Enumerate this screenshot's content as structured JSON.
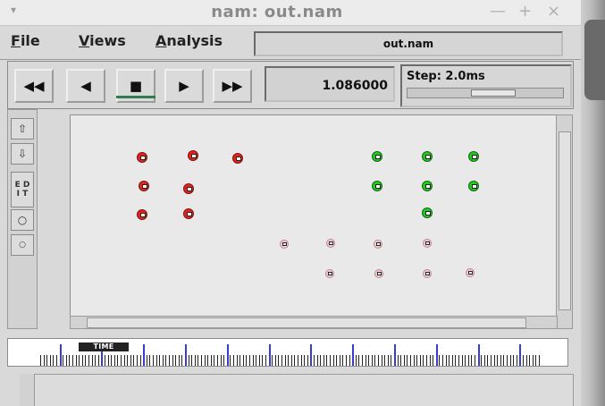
{
  "window": {
    "title": "nam: out.nam",
    "menu_arrow": "▾",
    "minimize": "—",
    "maximize": "+",
    "close": "×"
  },
  "menubar": {
    "items": [
      {
        "label": "File",
        "underline": "F",
        "rest": "ile"
      },
      {
        "label": "Views",
        "underline": "V",
        "rest": "iews"
      },
      {
        "label": "Analysis",
        "underline": "A",
        "rest": "nalysis"
      }
    ],
    "filename": "out.nam"
  },
  "playback": {
    "rewind": "◀◀",
    "back": "◀",
    "stop": "■",
    "play": "▶",
    "fast_forward": "▶▶",
    "time": "1.086000",
    "step_label": "Step: 2.0ms"
  },
  "tools": {
    "zoom_in": "⇧",
    "zoom_out": "⇩",
    "edit": "E D\nI T",
    "circle_large": "○",
    "circle_small": "○"
  },
  "timeline": {
    "label": "TIME"
  },
  "colors": {
    "node_red": "#e8231b",
    "node_green": "#1fcc1f",
    "node_pink": "#f4c8cf",
    "timeline_major_tick": "#3a3ad6"
  },
  "nodes": {
    "red_count": 7,
    "green_count": 7,
    "pink_count": 8
  }
}
